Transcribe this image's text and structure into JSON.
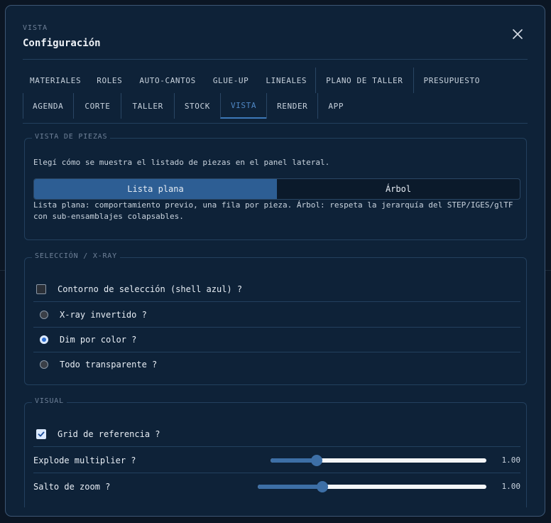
{
  "dialog": {
    "eyebrow": "VISTA",
    "title": "Configuración",
    "close_icon": "close-icon"
  },
  "tabs_row1": [
    {
      "label": "MATERIALES"
    },
    {
      "label": "ROLES"
    },
    {
      "label": "AUTO-CANTOS"
    },
    {
      "label": "GLUE-UP"
    },
    {
      "label": "LINEALES"
    },
    {
      "label": "PLANO DE TALLER"
    },
    {
      "label": "PRESUPUESTO"
    }
  ],
  "tabs_row2": [
    {
      "label": "AGENDA"
    },
    {
      "label": "CORTE"
    },
    {
      "label": "TALLER"
    },
    {
      "label": "STOCK"
    },
    {
      "label": "VISTA"
    },
    {
      "label": "RENDER"
    },
    {
      "label": "APP"
    }
  ],
  "active_tab": "VISTA",
  "vista_piezas": {
    "legend": "VISTA DE PIEZAS",
    "intro": "Elegí cómo se muestra el listado de piezas en el panel lateral.",
    "options": [
      {
        "label": "Lista plana",
        "selected": true
      },
      {
        "label": "Árbol",
        "selected": false
      }
    ],
    "help_line1": "Lista plana: comportamiento previo, una fila por pieza. Árbol: respeta la jerarquía del STEP/IGES/glTF",
    "help_line2": "con sub-ensamblajes colapsables."
  },
  "seleccion": {
    "legend": "SELECCIÓN / X-RAY",
    "checkbox_label": "Contorno de selección (shell azul) ?",
    "checkbox_checked": false,
    "radios": [
      {
        "label": "X-ray invertido ?",
        "checked": false
      },
      {
        "label": "Dim por color ?",
        "checked": true
      },
      {
        "label": "Todo transparente ?",
        "checked": false
      }
    ]
  },
  "visual": {
    "legend": "VISUAL",
    "grid_label": "Grid de referencia ?",
    "grid_checked": true,
    "sliders": [
      {
        "label": "Explode multiplier ?",
        "value_text": "1.00",
        "fraction": 0.215
      },
      {
        "label": "Salto de zoom ?",
        "value_text": "1.00",
        "fraction": 0.283
      }
    ]
  },
  "colors": {
    "accent": "#3d6fa6",
    "active_tab": "#4f87c4",
    "panel": "#0e2238",
    "border": "#3d5673"
  }
}
